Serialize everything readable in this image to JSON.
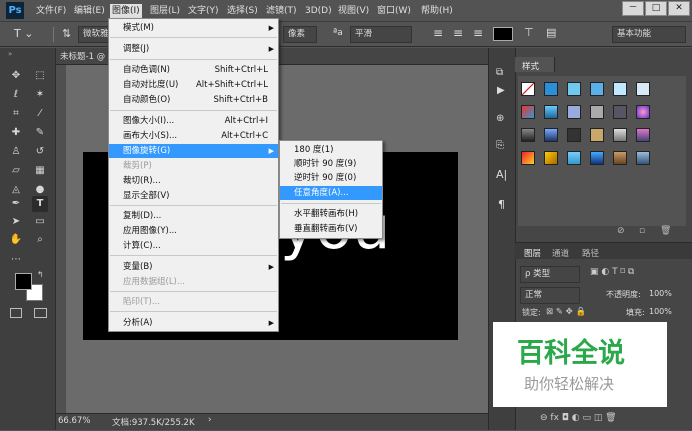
{
  "app": {
    "logo": "Ps"
  },
  "menubar": {
    "items": [
      "文件(F)",
      "编辑(E)",
      "图像(I)",
      "图层(L)",
      "文字(Y)",
      "选择(S)",
      "滤镜(T)",
      "3D(D)",
      "视图(V)",
      "窗口(W)",
      "帮助(H)"
    ]
  },
  "window": {
    "minimize": "－",
    "restore": "□",
    "close": "✕"
  },
  "options": {
    "font_family": "微软雅",
    "font_style": "像素",
    "aa_label": "ªa",
    "aa_value": "平滑",
    "workspace": "基本功能"
  },
  "document": {
    "tab_label": "未标题-1 @",
    "canvas_text": "you"
  },
  "status": {
    "zoom": "66.67%",
    "doc_size": "文档:937.5K/255.2K"
  },
  "image_menu": {
    "items": [
      {
        "label": "模式(M)",
        "shortcut": "",
        "submenu": true
      },
      {
        "label": "调整(J)",
        "shortcut": "",
        "submenu": true
      },
      {
        "label": "自动色调(N)",
        "shortcut": "Shift+Ctrl+L"
      },
      {
        "label": "自动对比度(U)",
        "shortcut": "Alt+Shift+Ctrl+L"
      },
      {
        "label": "自动颜色(O)",
        "shortcut": "Shift+Ctrl+B"
      },
      {
        "label": "图像大小(I)...",
        "shortcut": "Alt+Ctrl+I"
      },
      {
        "label": "画布大小(S)...",
        "shortcut": "Alt+Ctrl+C"
      },
      {
        "label": "图像旋转(G)",
        "shortcut": "",
        "submenu": true
      },
      {
        "label": "裁剪(P)",
        "shortcut": ""
      },
      {
        "label": "裁切(R)...",
        "shortcut": ""
      },
      {
        "label": "显示全部(V)",
        "shortcut": ""
      },
      {
        "label": "复制(D)...",
        "shortcut": ""
      },
      {
        "label": "应用图像(Y)...",
        "shortcut": ""
      },
      {
        "label": "计算(C)...",
        "shortcut": ""
      },
      {
        "label": "变量(B)",
        "shortcut": "",
        "submenu": true
      },
      {
        "label": "应用数据组(L)...",
        "shortcut": ""
      },
      {
        "label": "陷印(T)...",
        "shortcut": ""
      },
      {
        "label": "分析(A)",
        "shortcut": "",
        "submenu": true
      }
    ]
  },
  "rotate_menu": {
    "items": [
      "180 度(1)",
      "顺时针 90 度(9)",
      "逆时针 90 度(0)",
      "任意角度(A)...",
      "水平翻转画布(H)",
      "垂直翻转画布(V)"
    ]
  },
  "styles_panel": {
    "tab": "样式"
  },
  "layers_panel": {
    "tabs": [
      "图层",
      "通道",
      "路径"
    ],
    "filter": "ρ 类型",
    "blend": "正常",
    "opacity_label": "不透明度:",
    "opacity": "100%",
    "lock_label": "锁定:",
    "fill_label": "填充:",
    "fill": "100%"
  },
  "watermark": {
    "title": "百科全说",
    "subtitle": "助你轻松解决"
  },
  "colors": {
    "menu_highlight": "#3399ff",
    "watermark_green": "#2aa84a"
  }
}
